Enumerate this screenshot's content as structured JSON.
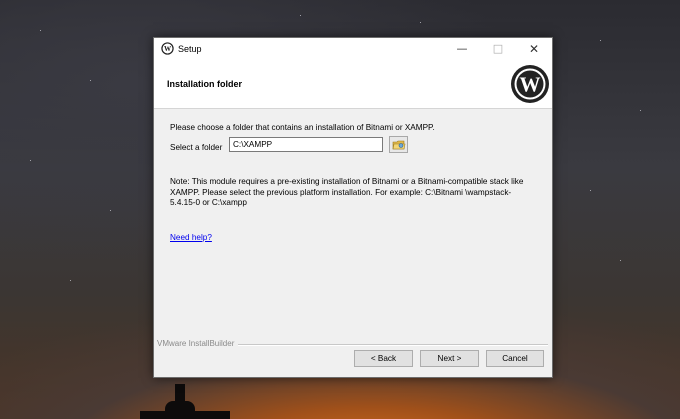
{
  "window": {
    "title": "Setup",
    "min_glyph": "—",
    "max_glyph": "□",
    "close_glyph": "✕"
  },
  "header": {
    "title": "Installation folder",
    "logo": "wordpress-logo"
  },
  "content": {
    "intro": "Please choose a folder that contains an installation of Bitnami or XAMPP.",
    "folder_label": "Select a folder",
    "folder_value": "C:\\XAMPP",
    "note": "Note: This module requires a pre-existing installation of Bitnami or a Bitnami-compatible stack like XAMPP. Please select the previous platform installation. For example: C:\\Bitnami \\wampstack-5.4.15-0 or C:\\xampp",
    "help_link": "Need help?"
  },
  "footer": {
    "brand": "VMware InstallBuilder",
    "back_label": "< Back",
    "next_label": "Next >",
    "cancel_label": "Cancel"
  },
  "icons": {
    "app": "wordpress-icon",
    "browse": "folder-browse-icon"
  }
}
